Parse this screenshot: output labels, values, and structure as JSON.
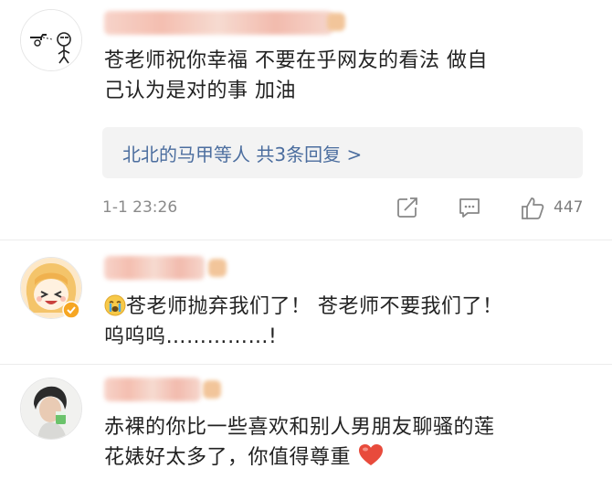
{
  "comments": [
    {
      "text_line1": "苍老师祝你幸福   不要在乎网友的看法   做自",
      "text_line2": "己认为是对的事  加油",
      "reply_summary": "北北的马甲等人  共3条回复 >",
      "time": "1-1 23:26",
      "like_count": "447",
      "icons": [
        "share-icon",
        "comment-icon",
        "like-icon"
      ]
    },
    {
      "text_line1": "苍老师抛弃我们了！ 苍老师不要我们了！",
      "text_line2": "呜呜呜……………!",
      "icons": [
        "crying-emoji-icon",
        "verified-badge-icon"
      ]
    },
    {
      "text_line1": "赤裸的你比一些喜欢和别人男朋友聊骚的莲",
      "text_line2": "花婊好太多了，你值得尊重",
      "icons": [
        "heart-icon"
      ]
    }
  ],
  "colors": {
    "link_blue": "#4c6e9f",
    "meta_gray": "#8a8a8a",
    "reply_bg": "#f3f3f3",
    "heart_red": "#e84b3c"
  }
}
